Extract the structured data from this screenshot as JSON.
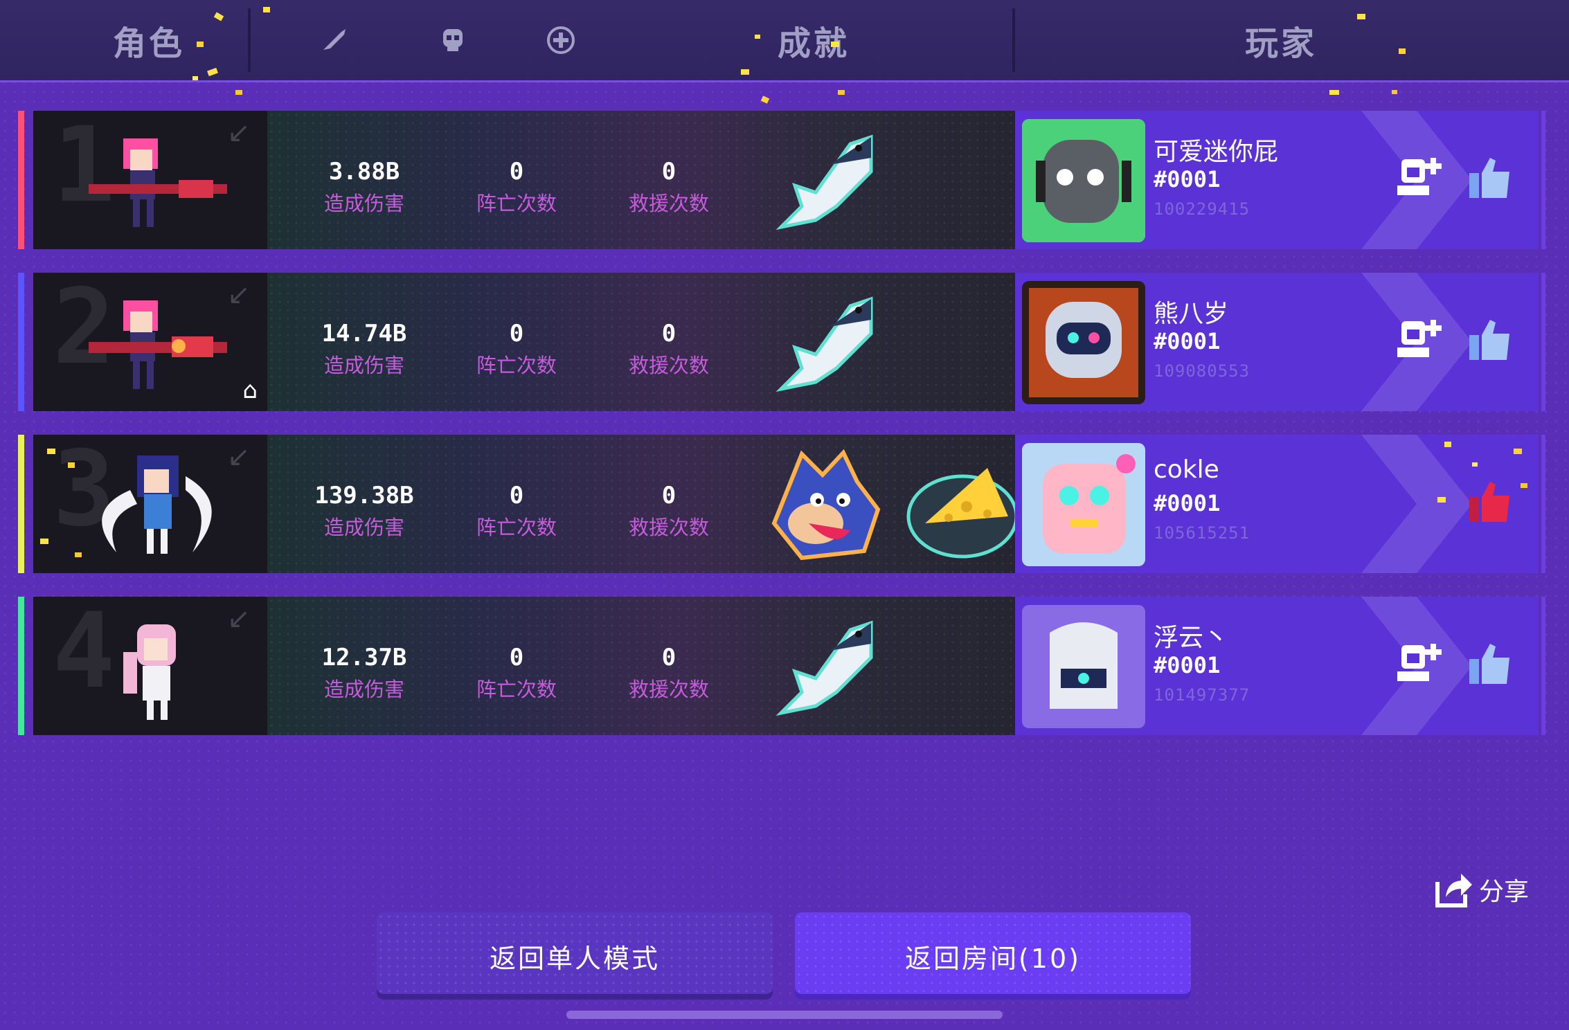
{
  "header": {
    "tab_role": "角色",
    "tab_achievement": "成就",
    "tab_player": "玩家",
    "icons": [
      "sword-icon",
      "skull-icon",
      "plus-circle-icon"
    ]
  },
  "stat_labels": {
    "damage": "造成伤害",
    "deaths": "阵亡次数",
    "rescues": "救援次数"
  },
  "rows": [
    {
      "rank": "1",
      "accent": "#ff4f7b",
      "damage": "3.88B",
      "deaths": "0",
      "rescues": "0",
      "badges": [
        "fish-badge"
      ],
      "player_name": "可爱迷你屁",
      "player_tag": "#0001",
      "player_id": "100229415",
      "liked": false
    },
    {
      "rank": "2",
      "accent": "#5b55ff",
      "damage": "14.74B",
      "deaths": "0",
      "rescues": "0",
      "badges": [
        "fish-badge"
      ],
      "player_name": "熊八岁",
      "player_tag": "#0001",
      "player_id": "109080553",
      "liked": false,
      "is_host": true
    },
    {
      "rank": "3",
      "accent": "#e8f25a",
      "damage": "139.38B",
      "deaths": "0",
      "rescues": "0",
      "badges": [
        "wolf-badge",
        "cheese-badge"
      ],
      "player_name": "cokle",
      "player_tag": "#0001",
      "player_id": "105615251",
      "liked": true
    },
    {
      "rank": "4",
      "accent": "#45e6a0",
      "damage": "12.37B",
      "deaths": "0",
      "rescues": "0",
      "badges": [
        "fish-badge"
      ],
      "player_name": "浮云丶",
      "player_tag": "#0001",
      "player_id": "101497377",
      "liked": false
    }
  ],
  "buttons": {
    "back_single": "返回单人模式",
    "back_room": "返回房间(10)"
  },
  "share_label": "分享",
  "colors": {
    "background": "#5a2eb6",
    "player_panel": "#5b32d6",
    "stat_label": "#c65bdc",
    "liked": "#e8284a",
    "unliked": "#7aa6f0"
  }
}
